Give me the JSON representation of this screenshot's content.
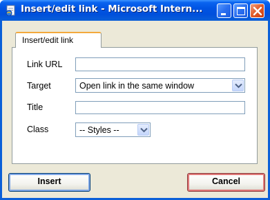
{
  "window": {
    "title": "Insert/edit link - Microsoft Intern...",
    "colors": {
      "titlebar": "#0054e3",
      "close": "#e05a28",
      "tab_highlight": "#f3a93c"
    }
  },
  "tabs": [
    {
      "label": "Insert/edit link",
      "active": true
    }
  ],
  "form": {
    "link_url": {
      "label": "Link URL",
      "value": ""
    },
    "target": {
      "label": "Target",
      "selected": "Open link in the same window"
    },
    "title": {
      "label": "Title",
      "value": ""
    },
    "class": {
      "label": "Class",
      "selected": "-- Styles --"
    }
  },
  "buttons": {
    "insert": "Insert",
    "cancel": "Cancel"
  },
  "icons": {
    "app": "ie-page-icon",
    "minimize": "minimize-icon",
    "maximize": "maximize-icon",
    "close": "close-icon",
    "dropdown": "chevron-down-icon"
  }
}
